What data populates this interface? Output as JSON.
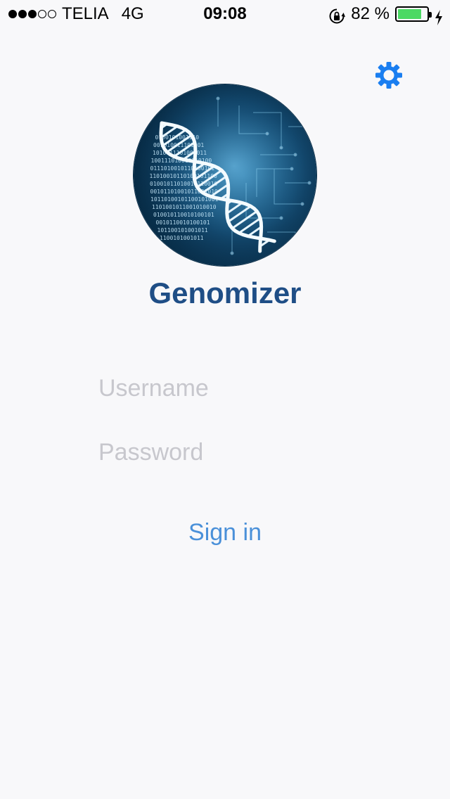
{
  "status_bar": {
    "signal_dots_filled": 3,
    "signal_dots_total": 5,
    "carrier": "TELIA",
    "network": "4G",
    "time": "09:08",
    "battery_text": "82 %",
    "battery_level": 0.82,
    "battery_color": "#4cd964"
  },
  "header": {
    "settings_icon": "gear-icon",
    "settings_color": "#1a7ef0"
  },
  "app": {
    "title": "Genomizer",
    "title_color": "#1f4e86",
    "logo": "dna-binary-logo"
  },
  "form": {
    "username_placeholder": "Username",
    "username_value": "",
    "password_placeholder": "Password",
    "password_value": "",
    "signin_label": "Sign in",
    "signin_color": "#4a90d9"
  }
}
